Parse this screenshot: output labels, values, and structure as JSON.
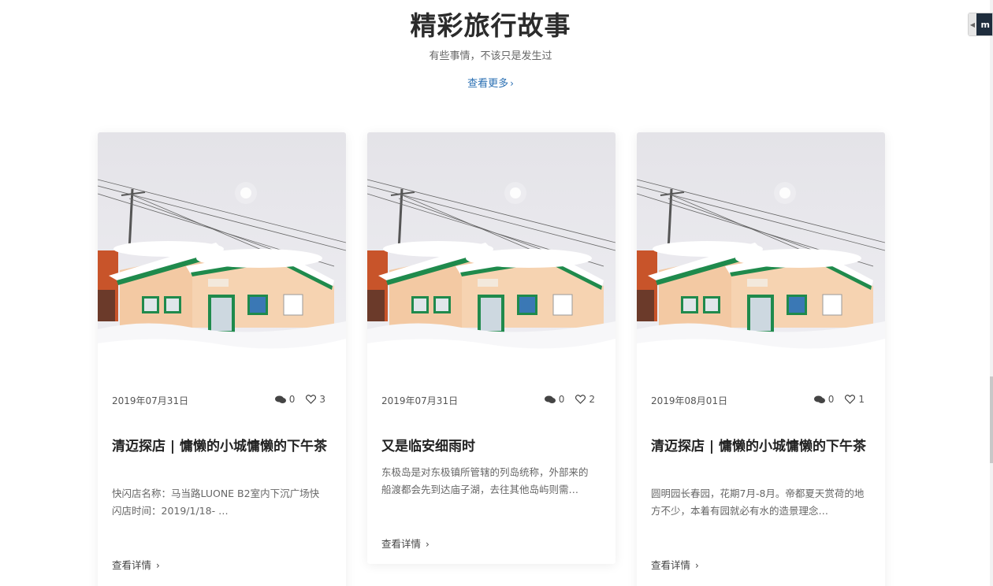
{
  "section": {
    "title": "精彩旅行故事",
    "subtitle": "有些事情，不该只是发生过",
    "view_more": "查看更多",
    "view_more_chevron": "›"
  },
  "side_widget": {
    "label": "m",
    "arrow": "◀"
  },
  "cards": [
    {
      "image_icon": "snow-house-photo",
      "date": "2019年07月31日",
      "comments": "0",
      "likes": "3",
      "title": "清迈探店 | 慵懒的小城慵懒的下午茶",
      "excerpt": "快闪店名称：马当路LUONE B2室内下沉广场快闪店时间：2019/1/18- …",
      "details": "查看详情",
      "details_chevron": "›"
    },
    {
      "image_icon": "snow-house-photo",
      "date": "2019年07月31日",
      "comments": "0",
      "likes": "2",
      "title": "又是临安细雨时",
      "excerpt": "东极岛是对东极镇所管辖的列岛统称，外部来的船渡都会先到达庙子湖，去往其他岛屿则需…",
      "details": "查看详情",
      "details_chevron": "›"
    },
    {
      "image_icon": "snow-house-photo",
      "date": "2019年08月01日",
      "comments": "0",
      "likes": "1",
      "title": "清迈探店 | 慵懒的小城慵懒的下午茶",
      "excerpt": "圆明园长春园，花期7月-8月。帝都夏天赏荷的地方不少，本着有园就必有水的造景理念…",
      "details": "查看详情",
      "details_chevron": "›"
    }
  ],
  "colors": {
    "link": "#2a6fb3",
    "title": "#2b2b2b",
    "house": "#f3c9a3",
    "trim": "#1f8a4c",
    "sky": "#e9e9ee"
  }
}
